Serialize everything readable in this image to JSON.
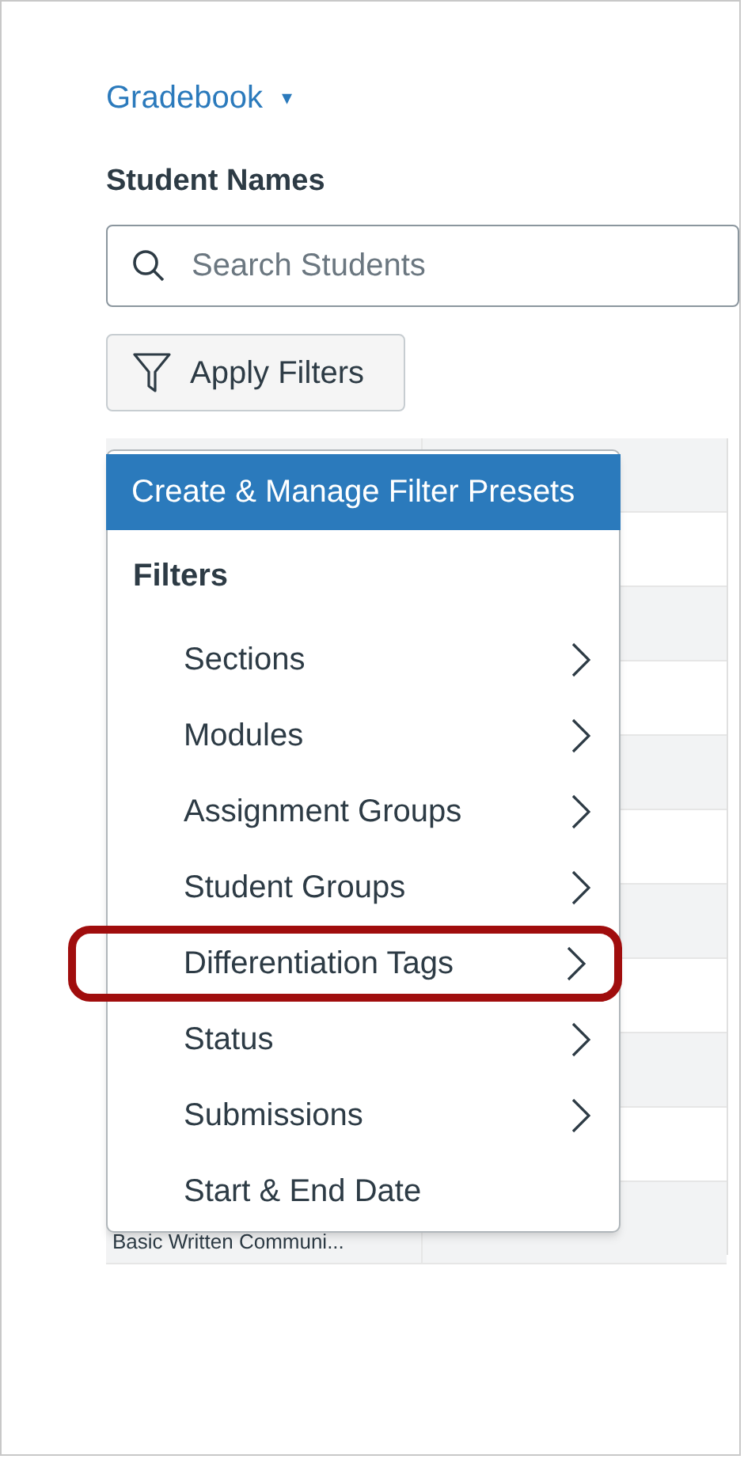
{
  "breadcrumb": {
    "label": "Gradebook",
    "caret": "▾"
  },
  "search": {
    "label": "Student Names",
    "placeholder": "Search Students"
  },
  "filter_button": {
    "label": "Apply Filters"
  },
  "grid": {
    "last_row_text": "Basic Written Communi..."
  },
  "menu": {
    "preset_action": {
      "label": "Create & Manage Filter Presets",
      "selected": true
    },
    "heading": "Filters",
    "items": [
      {
        "label": "Sections",
        "submenu": true,
        "highlighted": false
      },
      {
        "label": "Modules",
        "submenu": true,
        "highlighted": false
      },
      {
        "label": "Assignment Groups",
        "submenu": true,
        "highlighted": false
      },
      {
        "label": "Student Groups",
        "submenu": true,
        "highlighted": false
      },
      {
        "label": "Differentiation Tags",
        "submenu": true,
        "highlighted": true
      },
      {
        "label": "Status",
        "submenu": true,
        "highlighted": false
      },
      {
        "label": "Submissions",
        "submenu": true,
        "highlighted": false
      },
      {
        "label": "Start & End Date",
        "submenu": false,
        "highlighted": false
      }
    ]
  }
}
